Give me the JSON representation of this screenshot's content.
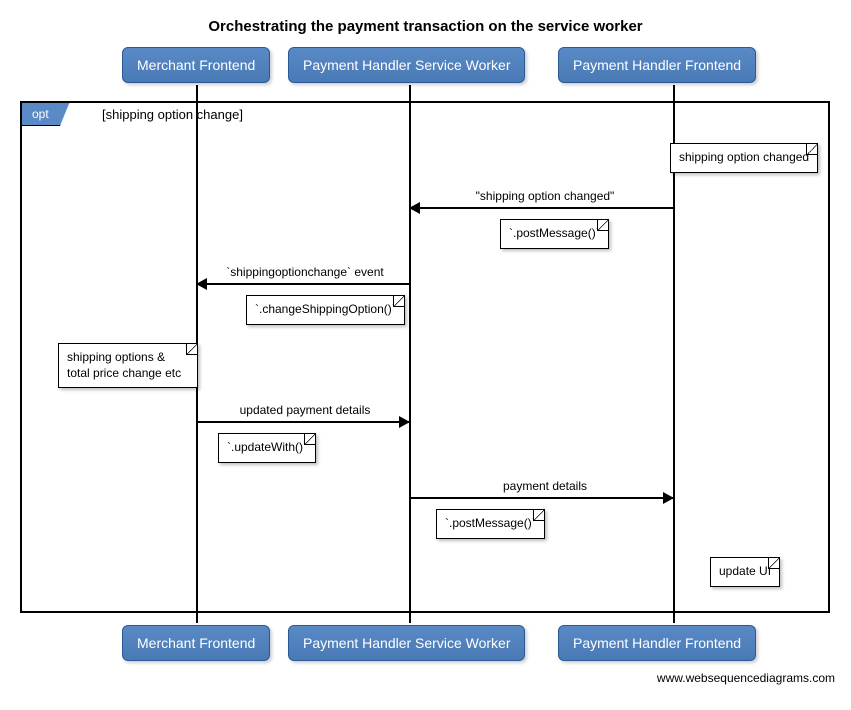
{
  "title": "Orchestrating the payment transaction on the service worker",
  "participants": {
    "p1": "Merchant Frontend",
    "p2": "Payment Handler Service Worker",
    "p3": "Payment Handler Frontend"
  },
  "opt": {
    "tag": "opt",
    "guard": "[shipping option change]"
  },
  "notes": {
    "n1": "shipping option changed",
    "n2": "`.postMessage()`",
    "n3": "`.changeShippingOption()`",
    "n4_line1": "shipping options &",
    "n4_line2": "total price change etc",
    "n5": "`.updateWith()`",
    "n6": "`.postMessage()`",
    "n7": "update UI"
  },
  "messages": {
    "m1": "\"shipping option changed\"",
    "m2": "`shippingoptionchange` event",
    "m3": "updated payment details",
    "m4": "payment details"
  },
  "watermark": "www.websequencediagrams.com",
  "chart_data": {
    "type": "sequence-diagram",
    "title": "Orchestrating the payment transaction on the service worker",
    "participants": [
      "Merchant Frontend",
      "Payment Handler Service Worker",
      "Payment Handler Frontend"
    ],
    "fragments": [
      {
        "type": "opt",
        "guard": "shipping option change",
        "events": [
          {
            "type": "note",
            "over": "Payment Handler Frontend",
            "text": "shipping option changed"
          },
          {
            "type": "message",
            "from": "Payment Handler Frontend",
            "to": "Payment Handler Service Worker",
            "label": "\"shipping option changed\"",
            "note": ".postMessage()"
          },
          {
            "type": "message",
            "from": "Payment Handler Service Worker",
            "to": "Merchant Frontend",
            "label": "`shippingoptionchange` event",
            "note": ".changeShippingOption()"
          },
          {
            "type": "note",
            "over": "Merchant Frontend",
            "text": "shipping options & total price change etc"
          },
          {
            "type": "message",
            "from": "Merchant Frontend",
            "to": "Payment Handler Service Worker",
            "label": "updated payment details",
            "note": ".updateWith()"
          },
          {
            "type": "message",
            "from": "Payment Handler Service Worker",
            "to": "Payment Handler Frontend",
            "label": "payment details",
            "note": ".postMessage()"
          },
          {
            "type": "note",
            "over": "Payment Handler Frontend",
            "text": "update UI"
          }
        ]
      }
    ]
  }
}
